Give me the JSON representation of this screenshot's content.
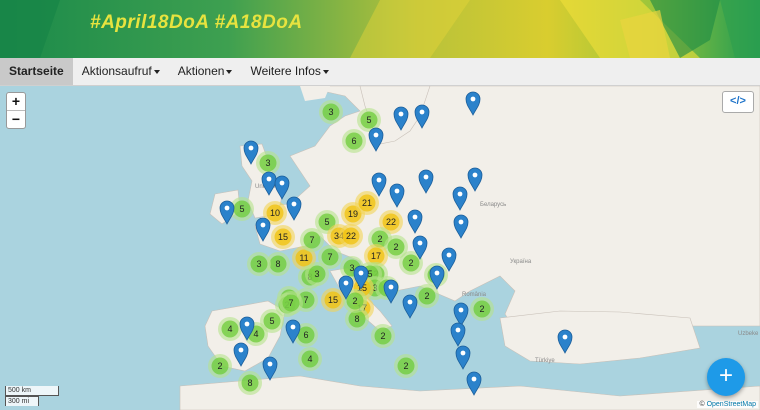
{
  "banner": {
    "title": "#April18DoA  #A18DoA"
  },
  "nav": [
    {
      "label": "Startseite"
    },
    {
      "label": "Aktionsaufruf"
    },
    {
      "label": "Aktionen"
    },
    {
      "label": "Weitere Infos"
    }
  ],
  "map": {
    "zoom_in": "+",
    "zoom_out": "−",
    "embed_icon": "</>",
    "scale": {
      "km": "500 km",
      "mi": "300 mi"
    },
    "attribution": {
      "prefix": "©",
      "link": "OpenStreetMap"
    },
    "add_button": "+",
    "cluster_labels": [
      "3",
      "5",
      "6",
      "3",
      "5",
      "10",
      "15",
      "5",
      "19",
      "21",
      "22",
      "34",
      "22",
      "8",
      "11",
      "2",
      "2",
      "7",
      "8",
      "3",
      "17",
      "3",
      "2",
      "7",
      "2",
      "2",
      "3",
      "5",
      "3",
      "15",
      "15",
      "2",
      "7",
      "5",
      "2",
      "17",
      "3",
      "8",
      "6",
      "5",
      "4",
      "4",
      "2",
      "2",
      "8",
      "4",
      "7",
      "2",
      "2",
      "2"
    ],
    "place_labels": [
      "Беларусь",
      "Україна",
      "România",
      "Türkiye",
      "Uzbeke",
      "United K"
    ]
  }
}
